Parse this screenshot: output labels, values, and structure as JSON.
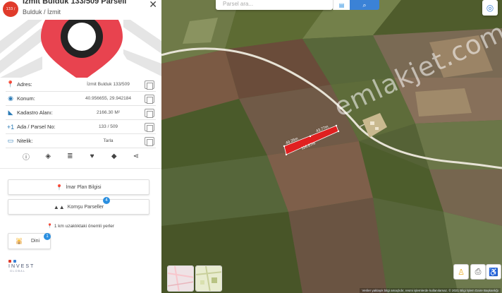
{
  "header": {
    "badge": "133 / 509",
    "title": "İzmit Bulduk 133/509 Parseli",
    "subtitle": "Bulduk / İzmit",
    "close_icon": "close-icon"
  },
  "details": [
    {
      "icon": "location-pin-icon",
      "label": "Adres:",
      "value": "İzmit Bulduk 133/509"
    },
    {
      "icon": "target-icon",
      "label": "Konum:",
      "value": "40.956655, 29.942184"
    },
    {
      "icon": "area-triangle-icon",
      "label": "Kadastro Alanı:",
      "value": "2166.30 M²"
    },
    {
      "icon": "plus-one-icon",
      "label": "Ada / Parsel No:",
      "value": "133 / 509"
    },
    {
      "icon": "tag-icon",
      "label": "Nitelik:",
      "value": "Tarla"
    }
  ],
  "actions": [
    "info-icon",
    "directions-icon",
    "route-icon",
    "heart-icon",
    "layers-icon",
    "share-icon"
  ],
  "buttons": {
    "imar": "İmar Plan Bilgisi",
    "komsu": "Komşu Parseller",
    "komsu_count": "4",
    "nearby": "1 km uzaklıktaki önemli yerler",
    "dini": "Dini",
    "dini_count": "1"
  },
  "logo": {
    "name": "INVEST",
    "sub": "GLOBAL"
  },
  "map": {
    "search_placeholder": "Parsel ara...",
    "watermark": "emlakjet.com",
    "measure_1": "49.35m",
    "measure_2": "43.77m",
    "measure_3": "116.87m",
    "footer": "Veriler yaklaşık bilgi amaçlıdır, resmi işlemlerde kullanılamaz. © 2021 Bilgi İşlem Daire Başkanlığı"
  },
  "colors": {
    "accent_red": "#e03b2b",
    "accent_blue": "#3b82d6",
    "parcel_red": "#e02020"
  }
}
